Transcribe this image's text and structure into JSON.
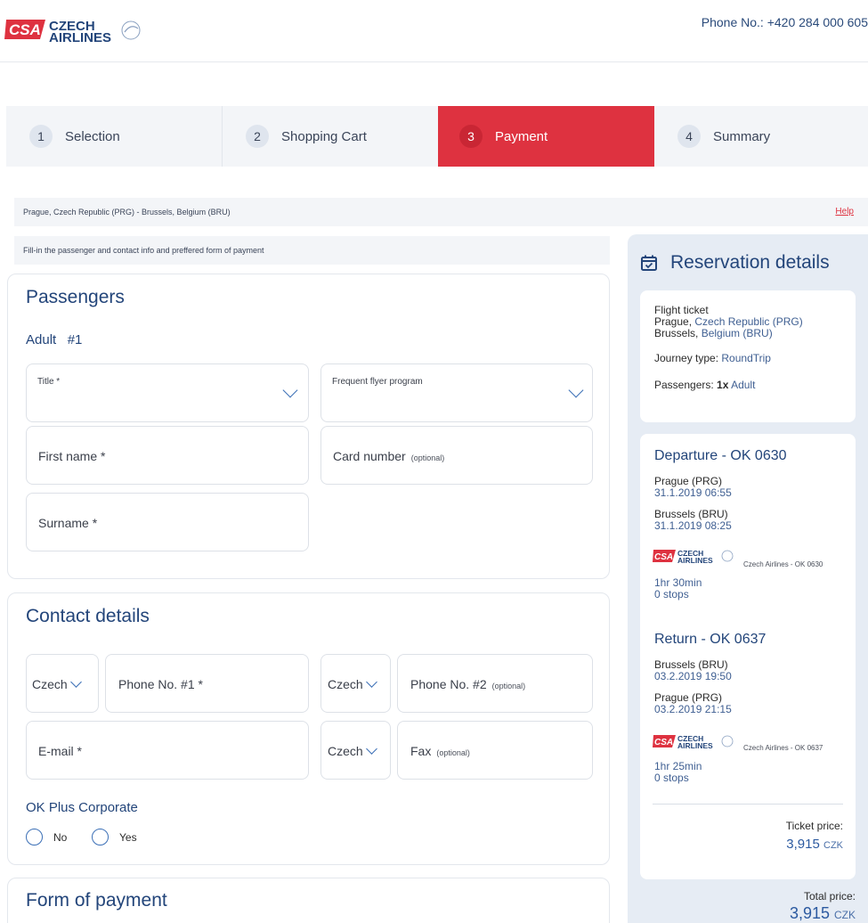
{
  "header": {
    "logo_text": "CSA CZECH AIRLINES",
    "phone_label": "Phone No.:",
    "phone_number": "+420 284 000 605"
  },
  "steps": [
    {
      "num": "1",
      "label": "Selection"
    },
    {
      "num": "2",
      "label": "Shopping Cart"
    },
    {
      "num": "3",
      "label": "Payment"
    },
    {
      "num": "4",
      "label": "Summary"
    }
  ],
  "route_bar": {
    "route": "Prague, Czech Republic (PRG) - Brussels, Belgium (BRU)",
    "help": "Help"
  },
  "info_text": "Fill-in the passenger and contact info and preffered form of payment",
  "passengers": {
    "title": "Passengers",
    "adult_label": "Adult",
    "adult_num": "#1",
    "title_field": "Title *",
    "ffp_field": "Frequent flyer program",
    "first_name": "First name *",
    "card_number": "Card number",
    "card_optional": "(optional)",
    "surname": "Surname *"
  },
  "contact": {
    "title": "Contact details",
    "prefix1": "Czech",
    "phone1": "Phone No. #1 *",
    "prefix2": "Czech",
    "phone2": "Phone No. #2",
    "phone2_optional": "(optional)",
    "email": "E-mail *",
    "prefix3": "Czech",
    "fax": "Fax",
    "fax_optional": "(optional)",
    "corporate_title": "OK Plus Corporate",
    "no": "No",
    "yes": "Yes"
  },
  "payment": {
    "title": "Form of payment"
  },
  "reservation": {
    "title": "Reservation details",
    "ticket_label": "Flight ticket",
    "origin_city": "Prague,",
    "origin_rest": "Czech Republic (PRG)",
    "dest_city": "Brussels,",
    "dest_rest": "Belgium (BRU)",
    "journey_label": "Journey type:",
    "journey_value": "RoundTrip",
    "passengers_label": "Passengers:",
    "passengers_count": "1x",
    "passengers_type": "Adult",
    "departure": {
      "title": "Departure - OK 0630",
      "from": "Prague (PRG)",
      "from_time": "31.1.2019 06:55",
      "to": "Brussels (BRU)",
      "to_time": "31.1.2019 08:25",
      "carrier": "Czech Airlines - OK 0630",
      "duration": "1hr 30min",
      "stops": "0 stops"
    },
    "return": {
      "title": "Return - OK 0637",
      "from": "Brussels (BRU)",
      "from_time": "03.2.2019 19:50",
      "to": "Prague (PRG)",
      "to_time": "03.2.2019 21:15",
      "carrier": "Czech Airlines - OK 0637",
      "duration": "1hr 25min",
      "stops": "0 stops"
    },
    "ticket_price_label": "Ticket price:",
    "ticket_price": "3,915",
    "currency": "CZK",
    "total_label": "Total price:",
    "total_price": "3,915",
    "total_currency": "CZK"
  },
  "colors": {
    "brand_red": "#de3240",
    "brand_blue": "#23457a",
    "panel": "#e6ecf4"
  }
}
